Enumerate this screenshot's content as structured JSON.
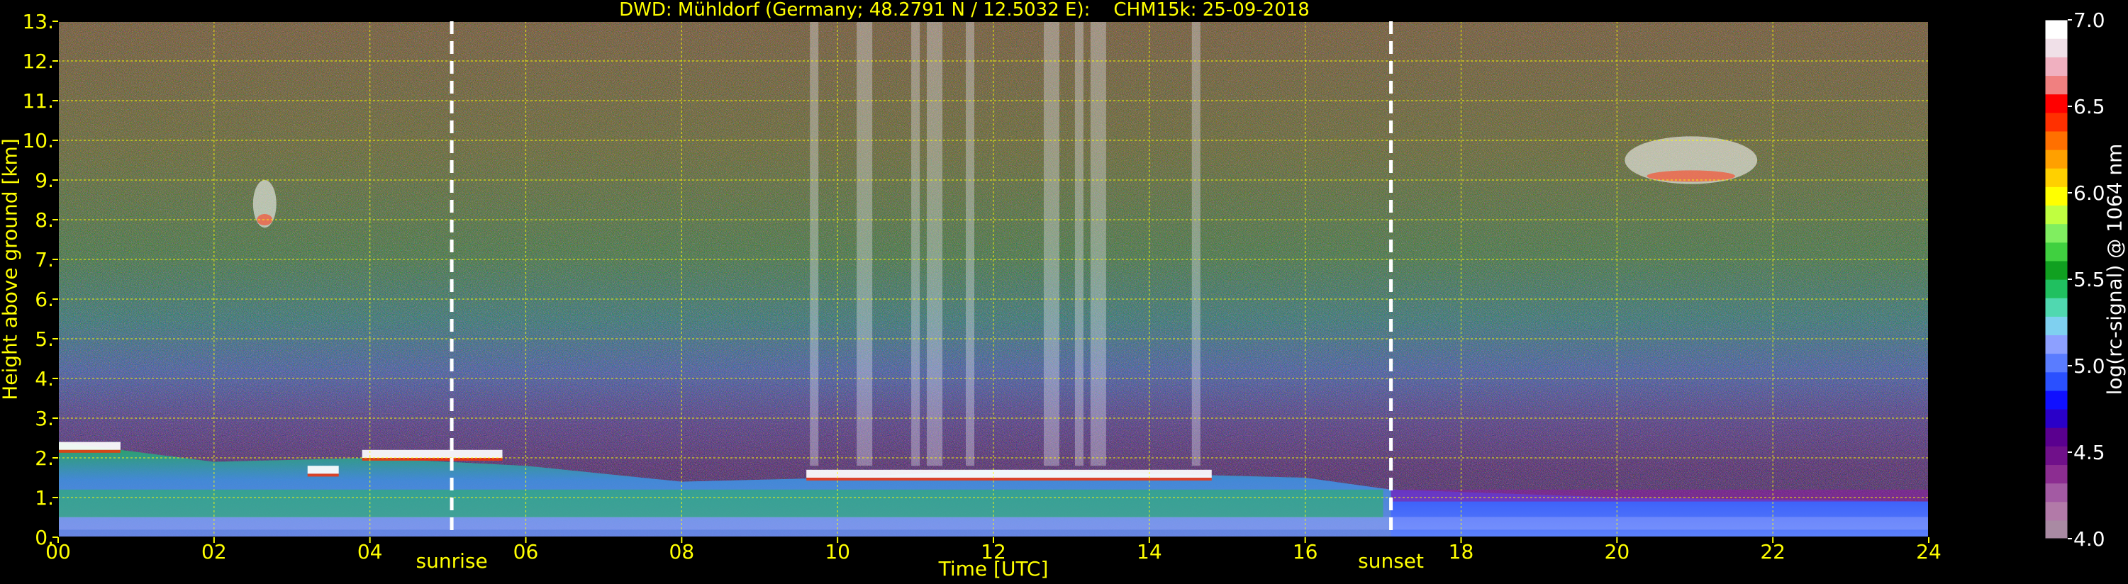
{
  "chart_data": {
    "type": "heatmap",
    "title": "DWD: Mühldorf (Germany; 48.2791 N / 12.5032 E):    CHM15k: 25-09-2018",
    "xlabel": "Time [UTC]",
    "ylabel": "Height above ground [km]",
    "xlim": [
      0,
      24
    ],
    "ylim": [
      0,
      13
    ],
    "x_ticks": [
      "00",
      "02",
      "04",
      "06",
      "08",
      "10",
      "12",
      "14",
      "16",
      "18",
      "20",
      "22",
      "24"
    ],
    "y_ticks": [
      "0.",
      "1.",
      "2.",
      "3.",
      "4.",
      "5.",
      "6.",
      "7.",
      "8.",
      "9.",
      "10.",
      "11.",
      "12.",
      "13."
    ],
    "grid": true,
    "annotations": [
      {
        "label": "sunrise",
        "x": 5.05
      },
      {
        "label": "sunset",
        "x": 17.1
      }
    ],
    "colorbar": {
      "label": "log(rc-signal) @ 1064 nm",
      "range": [
        4.0,
        7.0
      ],
      "ticks": [
        "4.0",
        "4.5",
        "5.0",
        "5.5",
        "6.0",
        "6.5",
        "7.0"
      ],
      "colors": [
        "#a98aa3",
        "#b27aa8",
        "#a35aa3",
        "#8c2d91",
        "#70108a",
        "#5a008f",
        "#2a00c8",
        "#1010ff",
        "#2a50ff",
        "#5a7cff",
        "#8da0ff",
        "#7fd0f0",
        "#50d8b0",
        "#20c060",
        "#10a020",
        "#40d040",
        "#80ee60",
        "#c0ff40",
        "#ffff00",
        "#ffd000",
        "#ffa000",
        "#ff7000",
        "#ff3000",
        "#ff0000",
        "#f08080",
        "#f0b0c0",
        "#f0e0e8",
        "#ffffff"
      ]
    },
    "features": {
      "boundary_layer_top_km": [
        {
          "x": 0,
          "y": 2.4
        },
        {
          "x": 2,
          "y": 1.9
        },
        {
          "x": 4,
          "y": 2.0
        },
        {
          "x": 6,
          "y": 1.8
        },
        {
          "x": 8,
          "y": 1.4
        },
        {
          "x": 10,
          "y": 1.5
        },
        {
          "x": 12,
          "y": 1.7
        },
        {
          "x": 14,
          "y": 1.6
        },
        {
          "x": 16,
          "y": 1.5
        },
        {
          "x": 17.1,
          "y": 1.2
        },
        {
          "x": 20,
          "y": 1.0
        },
        {
          "x": 24,
          "y": 0.9
        }
      ],
      "cloud_layers": [
        {
          "x_start": 0.0,
          "x_end": 0.8,
          "height_km": 2.3
        },
        {
          "x_start": 3.2,
          "x_end": 3.6,
          "height_km": 1.7
        },
        {
          "x_start": 3.9,
          "x_end": 5.7,
          "height_km": 2.1
        },
        {
          "x_start": 9.6,
          "x_end": 14.8,
          "height_km": 1.6
        }
      ],
      "cirrus": [
        {
          "x_start": 2.5,
          "x_end": 2.8,
          "height_km": 8.4
        },
        {
          "x_start": 20.1,
          "x_end": 21.8,
          "height_km": 9.5
        }
      ]
    }
  }
}
